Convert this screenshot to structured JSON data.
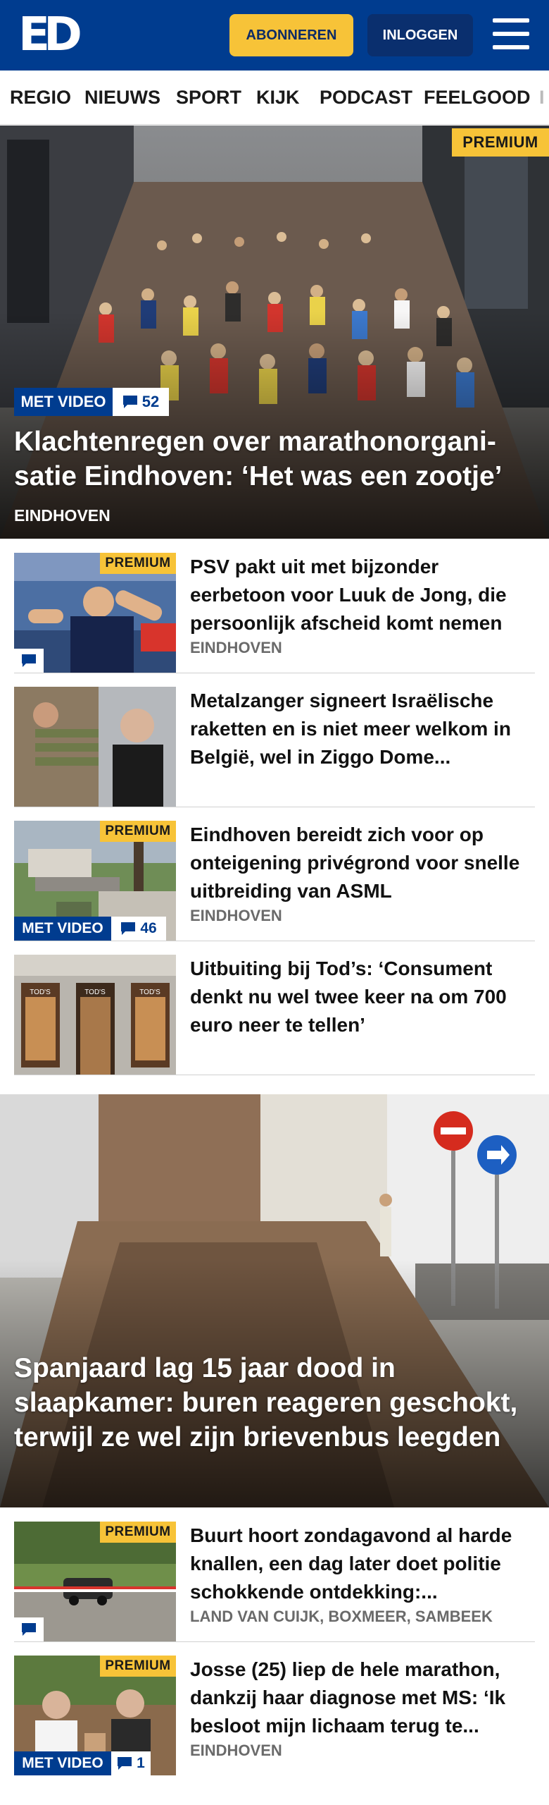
{
  "header": {
    "logo_text": "ED",
    "subscribe_label": "ABONNEREN",
    "login_label": "INLOGGEN",
    "background_color": "#003c8f",
    "subscribe_color": "#f7c338"
  },
  "nav": {
    "items": [
      "REGIO",
      "NIEUWS",
      "SPORT",
      "KIJK",
      "PODCAST",
      "FEELGOOD",
      "I"
    ]
  },
  "hero": {
    "premium_label": "PREMIUM",
    "video_label": "MET VIDEO",
    "comment_count": "52",
    "title": "Klachtenregen over marathonorgani-satie Eindhoven: ‘Het was een zootje’",
    "location": "EINDHOVEN"
  },
  "articles": [
    {
      "title": "PSV pakt uit met bijzonder eerbetoon voor Luuk de Jong, die persoonlijk afscheid komt nemen",
      "location": "EINDHOVEN",
      "premium_label": "PREMIUM"
    },
    {
      "title": "Metalzanger signeert Israëlische raketten en is niet meer welkom in België, wel in Ziggo Dome...",
      "location": ""
    },
    {
      "title": "Eindhoven bereidt zich voor op onteigening privégrond voor snelle uitbreiding van ASML",
      "location": "EINDHOVEN",
      "premium_label": "PREMIUM",
      "video_label": "MET VIDEO",
      "comment_count": "46"
    },
    {
      "title": "Uitbuiting bij Tod’s: ‘Consument denkt nu wel twee keer na om 700 euro neer te tellen’",
      "location": "",
      "thumb_shop_text": "TOD'S"
    }
  ],
  "feature": {
    "title": "Spanjaard lag 15 jaar dood in slaapkamer: buren reageren geschokt, terwijl ze wel zijn brievenbus leegden"
  },
  "articles_bottom": [
    {
      "title": "Buurt hoort zondagavond al harde knallen, een dag later doet politie schokkende ontdekking:...",
      "location": "LAND VAN CUIJK, BOXMEER, SAMBEEK",
      "premium_label": "PREMIUM"
    },
    {
      "title": "Josse (25) liep de hele marathon, dankzij haar diagnose met MS: ‘Ik besloot mijn lichaam terug te...",
      "location": "EINDHOVEN",
      "premium_label": "PREMIUM",
      "video_label": "MET VIDEO",
      "comment_count": "1"
    }
  ]
}
